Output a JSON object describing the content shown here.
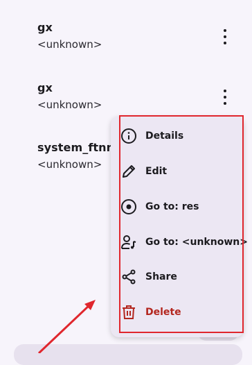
{
  "tracks": [
    {
      "title": "gx",
      "subtitle": "<unknown>"
    },
    {
      "title": "gx",
      "subtitle": "<unknown>"
    },
    {
      "title": "system_ftnn_",
      "subtitle": "<unknown>"
    }
  ],
  "context_menu": {
    "items": [
      {
        "label": "Details",
        "icon": "info-icon"
      },
      {
        "label": "Edit",
        "icon": "pencil-icon"
      },
      {
        "label": "Go to: res",
        "icon": "album-icon"
      },
      {
        "label": "Go to: <unknown>",
        "icon": "artist-icon"
      },
      {
        "label": "Share",
        "icon": "share-icon"
      },
      {
        "label": "Delete",
        "icon": "trash-icon"
      }
    ]
  },
  "colors": {
    "background": "#f7f4fb",
    "menu_background": "#ece7f3",
    "highlight": "#e0262d",
    "delete": "#b3261e",
    "annotation_arrow": "#e0262d"
  }
}
